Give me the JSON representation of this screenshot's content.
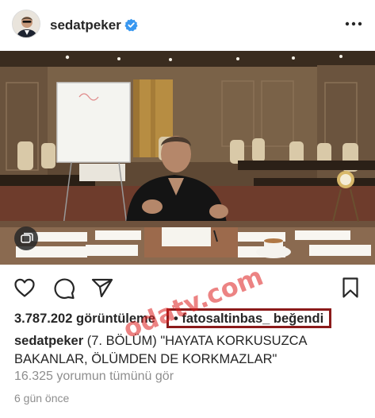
{
  "post": {
    "username": "sedatpeker",
    "verified": true,
    "verified_color": "#3897f0",
    "views": "3.787.202 görüntüleme",
    "separator": "•",
    "liked_by": "fatosaltinbas_ beğendi",
    "liked_highlight_color": "#8b1a1a",
    "caption_user": "sedatpeker",
    "caption_text": " (7. BÖLÜM) \"HAYATA KORKUSUZCA BAKANLAR, ÖLÜMDEN DE KORKMAZLAR\"",
    "comments_link": "16.325 yorumun tümünü gör",
    "time_ago": "6 gün önce"
  },
  "icons": {
    "more": "more-options-icon",
    "like": "heart-icon",
    "comment": "comment-icon",
    "share": "paper-plane-icon",
    "save": "bookmark-icon",
    "album": "video-album-icon"
  },
  "watermark": "odatv.com"
}
